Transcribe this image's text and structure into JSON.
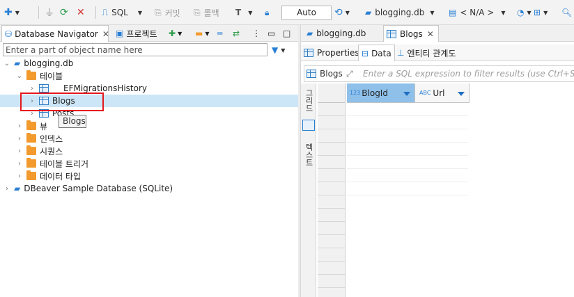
{
  "toolbar": {
    "sql_label": "SQL",
    "commit_label": "커밋",
    "rollback_label": "롤백",
    "transaction_mode": "Auto",
    "active_datasource": "blogging.db",
    "active_schema": "< N/A >"
  },
  "navigator": {
    "tab_label": "Database Navigator",
    "project_tab_label": "프로젝트",
    "filter_placeholder": "Enter a part of object name here",
    "tree": {
      "root": "blogging.db",
      "tables_folder": "테이블",
      "tables": [
        "_EFMigrationsHistory",
        "Blogs",
        "Posts"
      ],
      "views": "뷰",
      "indexes": "인덱스",
      "sequences": "시퀀스",
      "triggers": "테이블 트리거",
      "datatypes": "데이터 타입",
      "sample_db": "DBeaver Sample Database (SQLite)"
    },
    "tooltip": "Blogs",
    "highlight_color": "#e4171e"
  },
  "editor": {
    "tabs": [
      "blogging.db",
      "Blogs"
    ],
    "subtabs": [
      "Properties",
      "Data",
      "엔티티 관계도"
    ],
    "filter_table_label": "Blogs",
    "filter_placeholder": "Enter a SQL expression to filter results (use Ctrl+Space)",
    "side_tabs": [
      "그리드",
      "텍스트"
    ],
    "columns": [
      {
        "type_badge": "123",
        "name": "BlogId"
      },
      {
        "type_badge": "ABC",
        "name": "Url"
      }
    ],
    "selected_column_color": "#8fc0ea"
  }
}
